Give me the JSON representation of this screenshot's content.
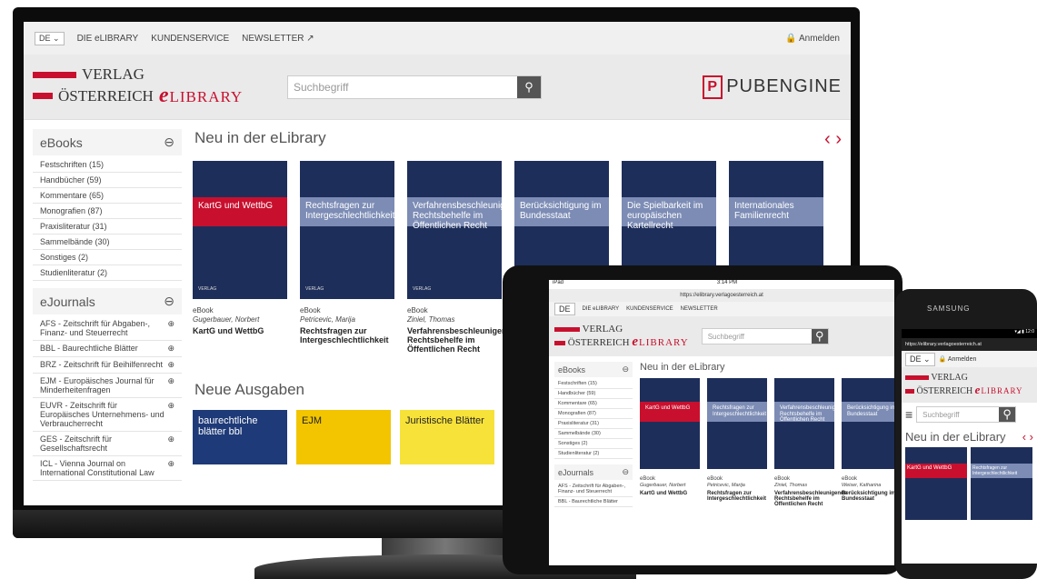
{
  "lang": "DE",
  "nav": [
    "DIE eLIBRARY",
    "KUNDENSERVICE",
    "NEWSLETTER"
  ],
  "login": "Anmelden",
  "logo": {
    "line1": "VERLAG",
    "line2": "ÖSTERREICH",
    "elib": "LIBRARY"
  },
  "search_placeholder": "Suchbegriff",
  "pubengine": "PUBENGINE",
  "ebooks_title": "eBooks",
  "ebooks": [
    "Festschriften (15)",
    "Handbücher (59)",
    "Kommentare (65)",
    "Monografien (87)",
    "Praxisliteratur (31)",
    "Sammelbände (30)",
    "Sonstiges (2)",
    "Studienliteratur (2)"
  ],
  "ejournals_title": "eJournals",
  "ejournals": [
    "AFS - Zeitschrift für Abgaben-, Finanz- und Steuerrecht",
    "BBL - Baurechtliche Blätter",
    "BRZ - Zeitschrift für Beihilfenrecht",
    "EJM - Europäisches Journal für Minderheitenfragen",
    "EUVR - Zeitschrift für Europäisches Unternehmens- und Verbraucherrecht",
    "GES - Zeitschrift für Gesellschaftsrecht",
    "ICL - Vienna Journal on International Constitutional Law"
  ],
  "new_title": "Neu in der eLibrary",
  "books": [
    {
      "cover": "KartG und WettbG",
      "type": "eBook",
      "author": "Gugerbauer, Norbert",
      "title": "KartG und WettbG"
    },
    {
      "cover": "Rechtsfragen zur Intergeschlechtlichkeit",
      "type": "eBook",
      "author": "Petricevic, Marija",
      "title": "Rechtsfragen zur Intergeschlechtlichkeit"
    },
    {
      "cover": "Verfahrensbeschleunigende Rechtsbehelfe im Öffentlichen Recht",
      "type": "eBook",
      "author": "Ziniel, Thomas",
      "title": "Verfahrensbeschleunigende Rechtsbehelfe im Öffentlichen Recht"
    },
    {
      "cover": "Berücksichtigung im Bundesstaat",
      "type": "",
      "author": "",
      "title": ""
    },
    {
      "cover": "Die Spielbarkeit im europäischen Kartellrecht",
      "type": "",
      "author": "",
      "title": ""
    },
    {
      "cover": "Internationales Familienrecht",
      "type": "",
      "author": "",
      "title": ""
    }
  ],
  "issues_title": "Neue Ausgaben",
  "issues": [
    "baurechtliche blätter bbl",
    "EJM",
    "Juristische Blätter"
  ],
  "tablet": {
    "carrier": "iPad",
    "time": "3:14 PM",
    "url": "https://elibrary.verlagoesterreich.at",
    "extra_author": "Weiser, Katharina",
    "extra_title": "Berücksichtigung im Bundesstaat"
  },
  "phone": {
    "brand": "SAMSUNG",
    "url": "https://elibrary.verlagoesterreich.at",
    "title": "Neu in der eLibrary"
  }
}
